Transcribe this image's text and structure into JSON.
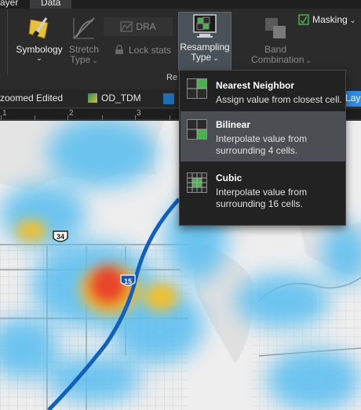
{
  "ribbon": {
    "tabs": [
      {
        "label": "ayer"
      },
      {
        "label": "Data"
      }
    ],
    "symbology": {
      "label": "Symbology"
    },
    "stretch_type": {
      "line1": "Stretch",
      "line2": "Type"
    },
    "dra": {
      "label": "DRA"
    },
    "lock_stats": {
      "label": "Lock stats"
    },
    "resampling_type": {
      "line1": "Resampling",
      "line2": "Type"
    },
    "band_combination": {
      "line1": "Band",
      "line2": "Combination"
    },
    "masking": {
      "label": "Masking"
    },
    "group_label": "Re",
    "chevron": "⌄"
  },
  "layer_tabs": {
    "zoomed_edited": "zoomed Edited",
    "od_tdm": "OD_TDM",
    "partial": "Lay"
  },
  "ruler": {
    "ticks": [
      "1",
      "2",
      "3"
    ]
  },
  "map": {
    "route_34": "34",
    "route_15": "15"
  },
  "resampling_menu": {
    "items": [
      {
        "title": "Nearest Neighbor",
        "description": "Assign value from closest cell."
      },
      {
        "title": "Bilinear",
        "description": "Interpolate value from surrounding 4 cells."
      },
      {
        "title": "Cubic",
        "description": "Interpolate value from surrounding 16 cells."
      }
    ],
    "selected": "Bilinear"
  },
  "colors": {
    "selected_item_bg": "#4b4f54",
    "accent_green": "#4caf50",
    "heat_red": "#e8442a",
    "heat_yellow": "#f0c030",
    "heat_blue": "#5fc0f0",
    "interstate_blue": "#1060c0"
  }
}
